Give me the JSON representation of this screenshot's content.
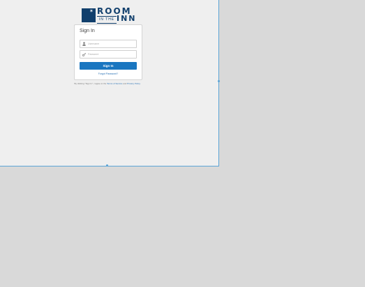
{
  "brand": {
    "line1": "ROOM",
    "small": "IN THE",
    "line2": "INN",
    "star": "✶",
    "color": "#113f6c"
  },
  "signin": {
    "title": "Sign In",
    "username_placeholder": "Username",
    "password_placeholder": "Password",
    "button_label": "Sign In",
    "forgot_label": "Forgot Password?",
    "accent": "#1a76c0"
  },
  "terms": {
    "prefix": "By clicking \"Sign In\", I agree to the",
    "terms_link": "Terms of Service",
    "and": "and",
    "privacy_link": "Privacy Policy."
  }
}
